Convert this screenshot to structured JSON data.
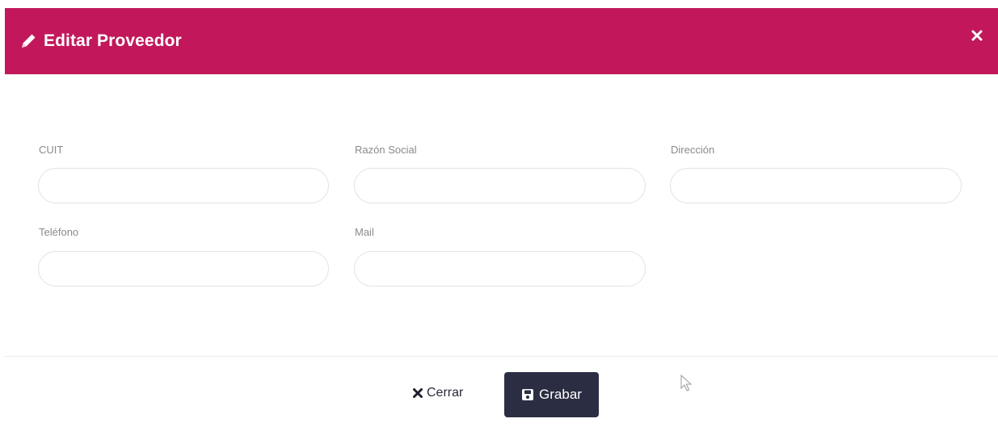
{
  "modal": {
    "title": "Editar Proveedor",
    "header_color": "#c2185b",
    "icons": {
      "title_icon": "pencil-icon",
      "close_icon": "close-icon"
    }
  },
  "form": {
    "fields": [
      {
        "label": "CUIT",
        "value": "",
        "placeholder": ""
      },
      {
        "label": "Razón Social",
        "value": "",
        "placeholder": ""
      },
      {
        "label": "Dirección",
        "value": "",
        "placeholder": ""
      },
      {
        "label": "Teléfono",
        "value": "",
        "placeholder": ""
      },
      {
        "label": "Mail",
        "value": "",
        "placeholder": ""
      }
    ]
  },
  "footer": {
    "cerrar_label": "Cerrar",
    "cerrar_icon": "times-icon",
    "grabar_label": "Grabar",
    "grabar_icon": "save-icon",
    "grabar_color": "#2b2d42"
  }
}
